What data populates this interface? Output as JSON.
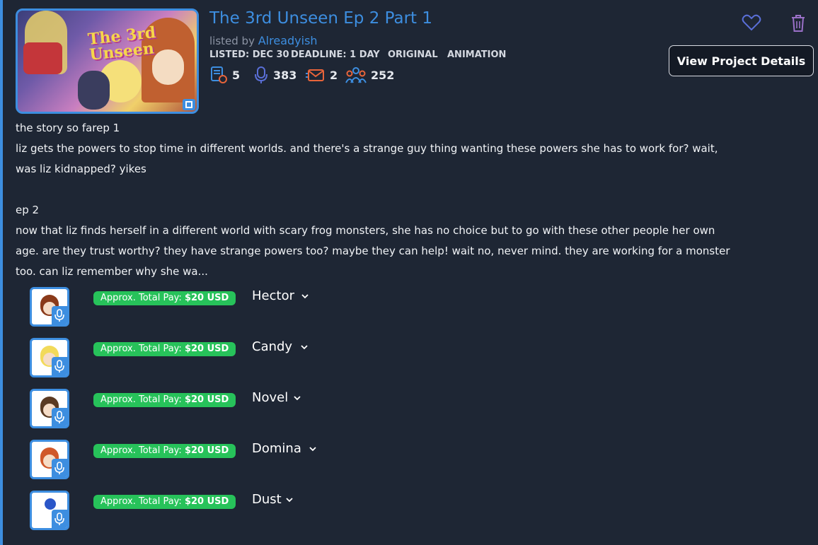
{
  "project": {
    "title": "The 3rd Unseen Ep 2 Part 1",
    "listed_by_prefix": "listed by",
    "author": "Alreadyish",
    "thumbnail_logo": "The 3rd Unseen",
    "listed": "LISTED: DEC 30",
    "deadline": "DEADLINE: 1 DAY",
    "type": "ORIGINAL",
    "category": "ANIMATION",
    "view_button": "View Project Details"
  },
  "stats": [
    {
      "icon": "script-icon",
      "value": "5"
    },
    {
      "icon": "microphone-icon",
      "value": "383"
    },
    {
      "icon": "mail-icon",
      "value": "2"
    },
    {
      "icon": "people-icon",
      "value": "252"
    }
  ],
  "description": {
    "lines": [
      "the story so farep 1",
      "liz gets the powers to stop time in different worlds. and there's a strange guy thing wanting these powers she has to work for? wait,",
      "was liz kidnapped? yikes",
      "",
      "ep 2",
      "now that liz finds herself in a different world with scary frog monsters, she has no choice but to go with these other people her own",
      "age. are they trust worthy? they have strange powers too? maybe they can help! wait no, never mind. they are working for a monster",
      "too. can liz remember why she wa..."
    ]
  },
  "roles": [
    {
      "name": "Hector",
      "pay_label": "Approx. Total Pay:",
      "pay_value": "$20 USD"
    },
    {
      "name": "Candy",
      "pay_label": "Approx. Total Pay:",
      "pay_value": "$20 USD"
    },
    {
      "name": "Novel",
      "pay_label": "Approx. Total Pay:",
      "pay_value": "$20 USD"
    },
    {
      "name": "Domina",
      "pay_label": "Approx. Total Pay:",
      "pay_value": "$20 USD"
    },
    {
      "name": "Dust",
      "pay_label": "Approx. Total Pay:",
      "pay_value": "$20 USD"
    }
  ],
  "colors": {
    "accent": "#3d8ee0",
    "background": "#1e2634",
    "pay_badge": "#27c25a",
    "heart": "#5a6fd8",
    "trash": "#9a70c8"
  }
}
